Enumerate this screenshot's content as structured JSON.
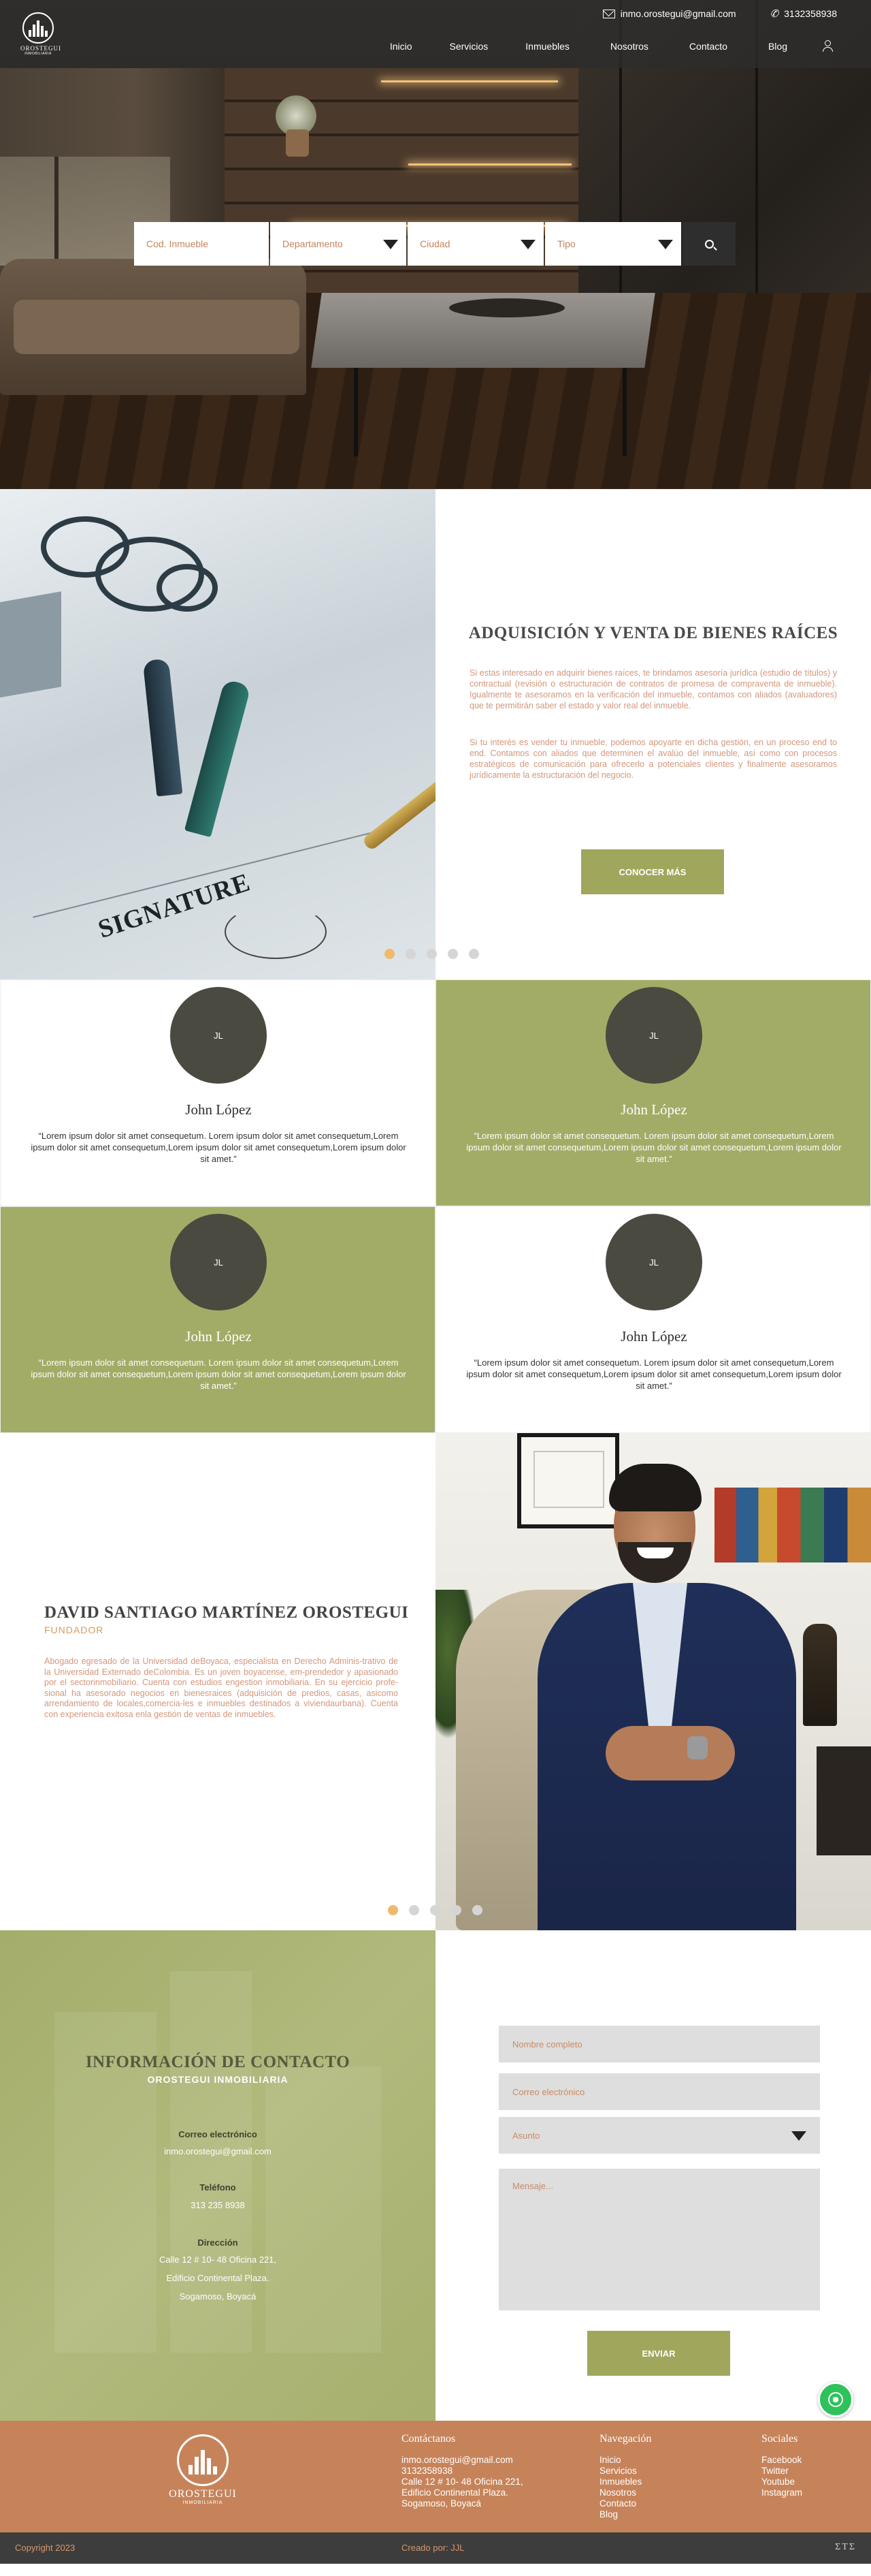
{
  "brand": {
    "logo_name": "OROSTEGUI",
    "logo_sub": "INMOBILIARIA"
  },
  "header": {
    "email": "inmo.orostegui@gmail.com",
    "phone": "3132358938",
    "nav": [
      "Inicio",
      "Servicios",
      "Inmuebles",
      "Nosotros",
      "Contacto",
      "Blog"
    ]
  },
  "search": {
    "code_placeholder": "Cod. Inmueble",
    "department": "Departamento",
    "city": "Ciudad",
    "type": "Tipo"
  },
  "service": {
    "title": "ADQUISICIÓN Y VENTA DE BIENES RAÍCES",
    "paragraph1": "Si estas interesado en adquirir bienes raíces, te brindamos asesoría jurídica (estudio de títulos) y contractual (revisión o estructuración de contratos de promesa de compraventa de inmueble). Igualmente te asesoramos en la verificación del inmueble, contamos con aliados (avaluadores) que te permitirán saber el estado y valor real del inmueble.",
    "paragraph2": "Si tu interés es vender tu inmueble, podemos apoyarte en dicha gestión, en un proceso end to end. Contamos con aliados que determinen el avalúo del inmueble, así como con procesos estratégicos de comunicación para ofrecerlo a potenciales clientes y finalmente asesoramos jurídicamente la estructuración del negocio.",
    "button": "CONOCER MÁS",
    "image_text": "SIGNATURE"
  },
  "testimonials": [
    {
      "initials": "JL",
      "name": "John López",
      "quote": "“Lorem ipsum dolor sit amet consequetum. Lorem ipsum dolor sit amet consequetum,Lorem ipsum dolor sit amet consequetum,Lorem ipsum dolor sit amet consequetum,Lorem ipsum dolor sit amet.”"
    },
    {
      "initials": "JL",
      "name": "John López",
      "quote": "“Lorem ipsum dolor sit amet consequetum. Lorem ipsum dolor sit amet consequetum,Lorem ipsum dolor sit amet consequetum,Lorem ipsum dolor sit amet consequetum,Lorem ipsum dolor sit amet.”"
    },
    {
      "initials": "JL",
      "name": "John López",
      "quote": "“Lorem ipsum dolor sit amet consequetum. Lorem ipsum dolor sit amet consequetum,Lorem ipsum dolor sit amet consequetum,Lorem ipsum dolor sit amet consequetum,Lorem ipsum dolor sit amet.”"
    },
    {
      "initials": "JL",
      "name": "John López",
      "quote": "“Lorem ipsum dolor sit amet consequetum. Lorem ipsum dolor sit amet consequetum,Lorem ipsum dolor sit amet consequetum,Lorem ipsum dolor sit amet consequetum,Lorem ipsum dolor sit amet.”"
    }
  ],
  "founder": {
    "name": "DAVID SANTIAGO MARTÍNEZ OROSTEGUI",
    "role": "FUNDADOR",
    "bio": "Abogado egresado de la Universidad deBoyaca, especialista en Derecho Adminis-trativo de la Universidad Externado deColombia. Es un joven boyacense, em-prendedor y apasionado por el sectorinmobiliario. Cuenta con estudios engestion inmobiliaria. En su ejercicio profe-sional ha asesorado negocios en bienesraices (adquisición de predios, casas, asicomo arrendamiento de locales,comercia-les e inmuebles destinados a viviendaurbana). Cuenta con experiencia exitosa enla gestión de ventas de inmuebles."
  },
  "contact": {
    "title": "INFORMACIÓN DE CONTACTO",
    "subtitle": "OROSTEGUI INMOBILIARIA",
    "email_label": "Correo electrónico",
    "email": "inmo.orostegui@gmail.com",
    "phone_label": "Teléfono",
    "phone": "313 235 8938",
    "address_label": "Dirección",
    "address_line1": "Calle 12 # 10- 48 Oficina 221,",
    "address_line2": "Edificio Continental Plaza.",
    "address_line3": "Sogamoso, Boyacá",
    "form": {
      "name_placeholder": "Nombre completo",
      "email_placeholder": "Correo electrónico",
      "subject": "Asunto",
      "message_placeholder": "Mensaje...",
      "submit": "ENVIAR"
    }
  },
  "footer": {
    "logo_name": "OROSTEGUI",
    "logo_sub": "INMOBILIARIA",
    "contact_title": "Contáctanos",
    "contact_lines": [
      "inmo.orostegui@gmail.com",
      "3132358938",
      "Calle 12 # 10- 48 Oficina 221,",
      "Edificio Continental Plaza.",
      "Sogamoso, Boyacá"
    ],
    "nav_title": "Navegación",
    "nav_links": [
      "Inicio",
      "Servicios",
      "Inmuebles",
      "Nosotros",
      "Contacto",
      "Blog"
    ],
    "social_title": "Sociales",
    "social_links": [
      "Facebook",
      "Twitter",
      "Youtube",
      "Instagram"
    ],
    "copyright": "Copyright 2023",
    "credit": "Creado por: JJL",
    "mark": "ΣΤΣ"
  },
  "colors": {
    "olive": "#a0a75d",
    "terracotta": "#c6835a",
    "dark": "#3d3d3d",
    "accent_text": "#d4967a"
  }
}
